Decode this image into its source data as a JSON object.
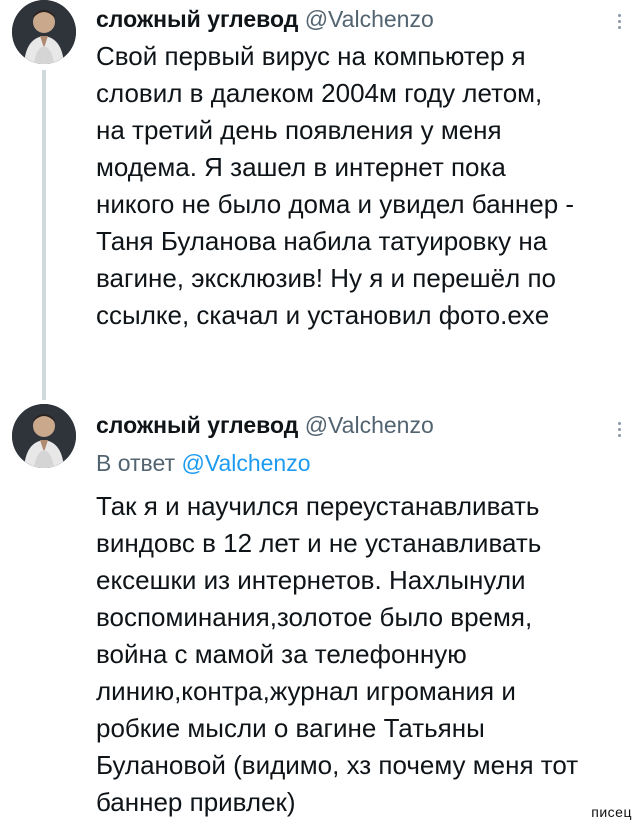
{
  "tweets": [
    {
      "author_name": "сложный углевод",
      "author_handle": "@Valchenzo",
      "lines": [
        "Свой первый вирус на компьютер я",
        "словил в далеком 2004м году летом,",
        "на третий день появления у меня",
        "модема. Я зашел в интернет пока",
        "никого не было дома и увидел баннер -",
        "Таня Буланова набила татуировку на",
        "вагине, эксклюзив! Ну я и перешёл по",
        "ссылке, скачал и установил фото.exe"
      ]
    },
    {
      "author_name": "сложный углевод",
      "author_handle": "@Valchenzo",
      "reply_prefix": "В ответ",
      "reply_handle": "@Valchenzo",
      "lines": [
        "Так я и научился переустанавливать",
        "виндовс в 12 лет и не устанавливать",
        "ексешки из интернетов. Нахлынули",
        "воспоминания,золотое было время,",
        "война с мамой за телефонную",
        "линию,контра,журнал игромания и",
        "робкие мысли о вагине Татьяны",
        "Булановой (видимо, хз почему меня тот",
        "баннер привлек)"
      ]
    }
  ],
  "watermark": "писец",
  "colors": {
    "text": "#0f1419",
    "secondary": "#536471",
    "link": "#1d9bf0",
    "thread_line": "#cfd9de"
  },
  "icons": {
    "more": "more-vertical-icon"
  }
}
